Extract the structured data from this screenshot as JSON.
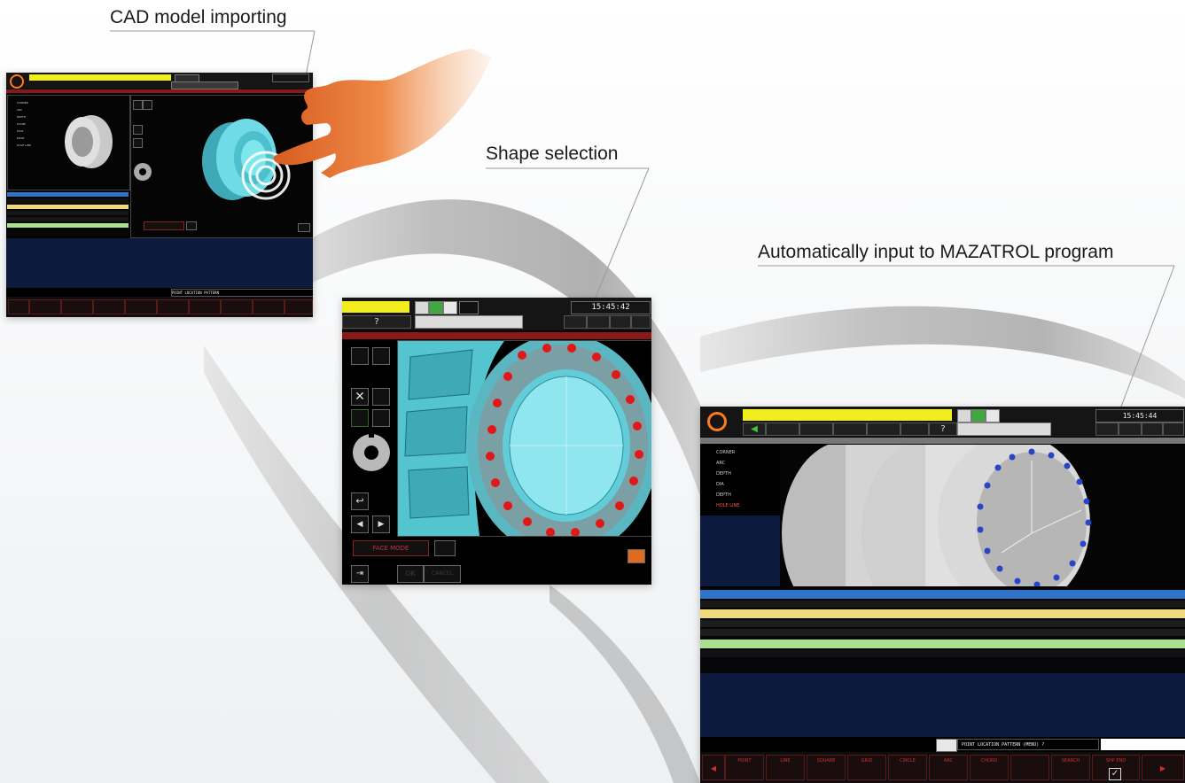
{
  "captions": {
    "step1": "CAD model importing",
    "step2": "Shape selection",
    "step3": "Automatically input to MAZATROL program"
  },
  "screen1": {
    "menu_items": [
      "CORNER",
      "ARC",
      "DEPTH",
      "PLANE",
      "FACE",
      "EDGE",
      "HOLE LINE"
    ],
    "message": "POINT LOCATION PATTERN"
  },
  "screen2": {
    "clock": "15:45:42",
    "help_label": "?",
    "select_button": "FACE MODE",
    "ok_label": "OK",
    "cancel_label": "CANCEL"
  },
  "screen3": {
    "clock": "15:45:44",
    "help_label": "?",
    "tree_items": [
      "CORNER",
      "ARC",
      "DEPTH",
      "DIA",
      "DEPTH",
      "HOLE LINE"
    ],
    "message": "POINT LOCATION PATTERN  (MENU) ?",
    "softkeys": [
      "POINT",
      "LINE",
      "SQUARE",
      "GRID",
      "CIRCLE",
      "ARC",
      "CHORD",
      "",
      "SEARCH",
      "SHP END"
    ]
  },
  "icons": {
    "hand": "pointing-hand-icon",
    "touch": "touch-ripple-icon"
  },
  "colors": {
    "mazak_yellow": "#f2ee1e",
    "model_cyan": "#66d9e6",
    "hole_red": "#e01818",
    "hole_blue": "#2844c8",
    "screen_navy": "#0b1a3d",
    "hand_orange": "#ec8240"
  }
}
